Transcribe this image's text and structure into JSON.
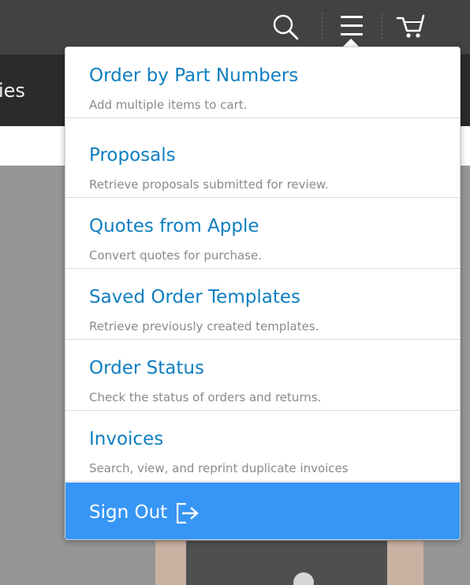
{
  "header": {
    "subnav_label": "ies",
    "icons": {
      "search": "search-icon",
      "menu": "menu-icon",
      "cart": "cart-icon"
    }
  },
  "menu": {
    "items": [
      {
        "title": "Order by Part Numbers",
        "description": "Add multiple items to cart."
      },
      {
        "title": "Proposals",
        "description": "Retrieve proposals submitted for review."
      },
      {
        "title": "Quotes from Apple",
        "description": "Convert quotes for purchase."
      },
      {
        "title": "Saved Order Templates",
        "description": "Retrieve previously created templates."
      },
      {
        "title": "Order Status",
        "description": "Check the status of orders and returns."
      },
      {
        "title": "Invoices",
        "description": "Search, view, and reprint duplicate invoices"
      }
    ],
    "sign_out_label": "Sign Out",
    "sign_out_icon": "sign-out-icon"
  },
  "colors": {
    "link": "#0e7ec0",
    "accent": "#3796f5",
    "topbar": "#424242",
    "subnav": "#2b2b2b"
  }
}
